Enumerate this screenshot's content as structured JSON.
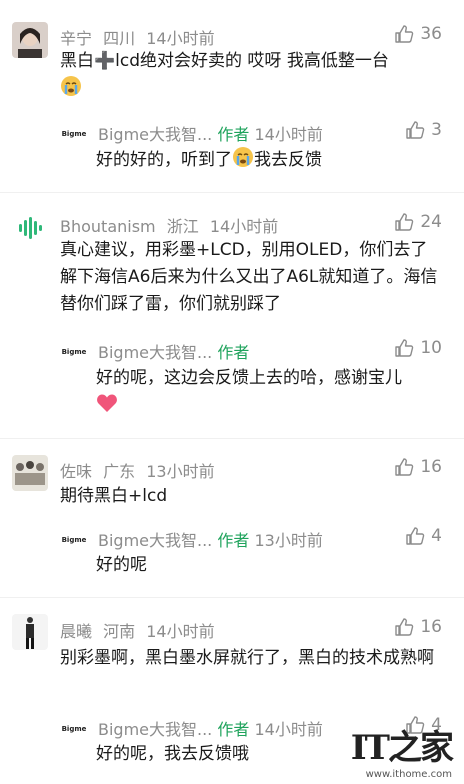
{
  "comments": [
    {
      "user": "辛宁",
      "region": "四川",
      "time": "14小时前",
      "likes": "36",
      "text": "黑白➕lcd绝对会好卖的 哎呀 我高低整一台",
      "emoji": "crying-face",
      "reply": {
        "user": "Bigme大我智...",
        "tag": "作者",
        "time": "14小时前",
        "likes": "3",
        "text_before": "好的好的，听到了",
        "text_after": "我去反馈",
        "emoji": "crying-face"
      }
    },
    {
      "user": "Bhoutanism",
      "region": "浙江",
      "time": "14小时前",
      "likes": "24",
      "text": "真心建议，用彩墨+LCD，别用OLED，你们去了解下海信A6后来为什么又出了A6L就知道了。海信替你们踩了雷，你们就别踩了",
      "reply": {
        "user": "Bigme大我智...",
        "tag": "作者",
        "time": "",
        "likes": "10",
        "text": "好的呢，这边会反馈上去的哈，感谢宝儿",
        "emoji": "heart"
      }
    },
    {
      "user": "佐味",
      "region": "广东",
      "time": "13小时前",
      "likes": "16",
      "text": "期待黑白+lcd",
      "reply": {
        "user": "Bigme大我智...",
        "tag": "作者",
        "time": "13小时前",
        "likes": "4",
        "text": "好的呢"
      }
    },
    {
      "user": "晨曦",
      "region": "河南",
      "time": "14小时前",
      "likes": "16",
      "text": "别彩墨啊，黑白墨水屏就行了，黑白的技术成熟啊",
      "reply": {
        "user": "Bigme大我智...",
        "tag": "作者",
        "time": "14小时前",
        "likes": "4",
        "text": "好的呢，我去反馈哦"
      }
    }
  ],
  "reply_avatar_text": "Bigme",
  "watermark": {
    "logo": "IT之家",
    "url": "www.ithome.com"
  },
  "colors": {
    "author_tag": "#1fa35c",
    "meta": "#8c8c8c",
    "heart": "#f0557a"
  }
}
